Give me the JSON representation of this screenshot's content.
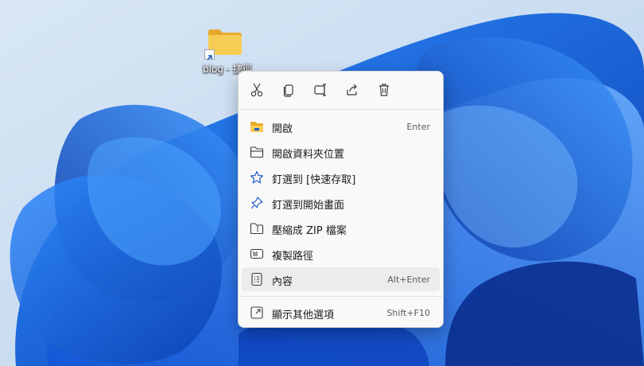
{
  "desktop": {
    "shortcut": {
      "label": "blog - 捷徑"
    }
  },
  "context_menu": {
    "quick_actions": [
      {
        "icon": "cut-icon"
      },
      {
        "icon": "copy-icon"
      },
      {
        "icon": "rename-icon"
      },
      {
        "icon": "share-icon"
      },
      {
        "icon": "delete-icon"
      }
    ],
    "items": [
      {
        "icon": "open-folder-icon",
        "label": "開啟",
        "shortcut": "Enter"
      },
      {
        "icon": "folder-icon",
        "label": "開啟資料夾位置",
        "shortcut": ""
      },
      {
        "icon": "star-icon",
        "label": "釘選到 [快速存取]",
        "shortcut": ""
      },
      {
        "icon": "pin-icon",
        "label": "釘選到開始畫面",
        "shortcut": ""
      },
      {
        "icon": "zip-icon",
        "label": "壓縮成 ZIP 檔案",
        "shortcut": ""
      },
      {
        "icon": "copy-path-icon",
        "label": "複製路徑",
        "shortcut": ""
      },
      {
        "icon": "properties-icon",
        "label": "內容",
        "shortcut": "Alt+Enter"
      },
      {
        "icon": "more-options-icon",
        "label": "顯示其他選項",
        "shortcut": "Shift+F10"
      }
    ],
    "hovered_item": "內容"
  },
  "colors": {
    "accent": "#0a5fd1",
    "folder_yellow": "#f5c542",
    "menu_bg": "#f9f9f9"
  }
}
